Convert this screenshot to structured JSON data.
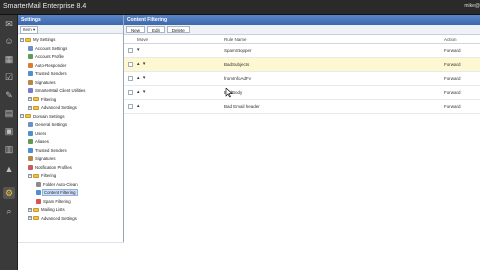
{
  "app": {
    "title": "SmarterMail Enterprise 8.4",
    "user": "mike@"
  },
  "leftbar": {
    "icons": [
      "mail-icon",
      "contacts-icon",
      "calendar-icon",
      "tasks-icon",
      "notes-icon",
      "news-icon",
      "files-icon",
      "reports-icon",
      "alerts-icon",
      "settings-icon",
      "search-icon"
    ]
  },
  "settings_panel": {
    "title": "Settings",
    "item_button": "Item ▾",
    "tree": [
      {
        "label": "My Settings",
        "level": 0,
        "type": "folder",
        "expanded": true
      },
      {
        "label": "Account Settings",
        "level": 1,
        "type": "leaf",
        "color": "#6a8fc9"
      },
      {
        "label": "Account Profile",
        "level": 1,
        "type": "leaf",
        "color": "#5d9c52"
      },
      {
        "label": "Auto-Responder",
        "level": 1,
        "type": "leaf",
        "color": "#d97c35"
      },
      {
        "label": "Trusted Senders",
        "level": 1,
        "type": "leaf",
        "color": "#4d8fcf"
      },
      {
        "label": "Signatures",
        "level": 1,
        "type": "leaf",
        "color": "#b5884a"
      },
      {
        "label": "SmarterMail Client Utilities",
        "level": 1,
        "type": "leaf",
        "color": "#7a7ad0"
      },
      {
        "label": "Filtering",
        "level": 1,
        "type": "folder",
        "expanded": false
      },
      {
        "label": "Advanced Settings",
        "level": 1,
        "type": "folder",
        "expanded": false
      },
      {
        "label": "Domain Settings",
        "level": 0,
        "type": "folder",
        "expanded": true
      },
      {
        "label": "General Settings",
        "level": 1,
        "type": "leaf",
        "color": "#6a8fc9"
      },
      {
        "label": "Users",
        "level": 1,
        "type": "leaf",
        "color": "#4d8fcf"
      },
      {
        "label": "Aliases",
        "level": 1,
        "type": "leaf",
        "color": "#5d9c52"
      },
      {
        "label": "Trusted Senders",
        "level": 1,
        "type": "leaf",
        "color": "#4d8fcf"
      },
      {
        "label": "Signatures",
        "level": 1,
        "type": "leaf",
        "color": "#b5884a"
      },
      {
        "label": "Notification Profiles",
        "level": 1,
        "type": "leaf",
        "color": "#c95d5d"
      },
      {
        "label": "Filtering",
        "level": 1,
        "type": "folder",
        "expanded": true
      },
      {
        "label": "Folder Auto-Clean",
        "level": 2,
        "type": "leaf",
        "color": "#8c8c8c"
      },
      {
        "label": "Content Filtering",
        "level": 2,
        "type": "leaf",
        "color": "#4d8fcf",
        "selected": true
      },
      {
        "label": "Spam Filtering",
        "level": 2,
        "type": "leaf",
        "color": "#d9534f"
      },
      {
        "label": "Mailing Lists",
        "level": 1,
        "type": "folder",
        "expanded": false
      },
      {
        "label": "Advanced Settings",
        "level": 1,
        "type": "folder",
        "expanded": false
      }
    ]
  },
  "content_panel": {
    "title": "Content Filtering",
    "toolbar": {
      "new_label": "New",
      "edit_label": "Edit",
      "delete_label": "Delete"
    },
    "columns": {
      "move": "Move",
      "rule_name": "Rule Name",
      "action": "Action"
    },
    "rows": [
      {
        "move": "▾",
        "name": "SpamStopper",
        "action": "Forward",
        "highlight": false
      },
      {
        "move": "▴ ▾",
        "name": "BadSubjects",
        "action": "Forward",
        "highlight": true
      },
      {
        "move": "▴ ▾",
        "name": "fromInfoAdFv",
        "action": "Forward",
        "highlight": false
      },
      {
        "move": "▴ ▾",
        "name": "BadBody",
        "action": "Forward",
        "highlight": false
      },
      {
        "move": "▴",
        "name": "Bad Email header",
        "action": "Forward",
        "highlight": false
      }
    ]
  },
  "colors": {
    "header_blue": "#3c67ab",
    "highlight_row": "#fdf7d2",
    "titlebar": "#2a2a2a"
  }
}
